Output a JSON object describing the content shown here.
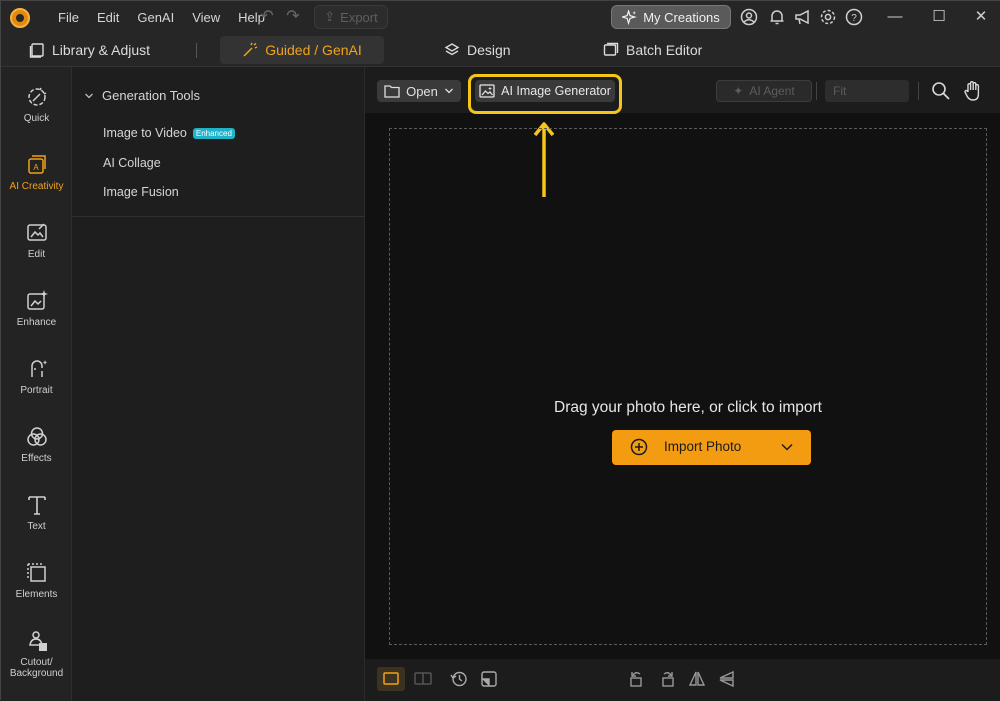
{
  "menu": [
    "File",
    "Edit",
    "GenAI",
    "View",
    "Help"
  ],
  "toolbar_top": {
    "export_label": "Export",
    "my_creations_label": "My Creations"
  },
  "nav": {
    "library": "Library & Adjust",
    "guided": "Guided / GenAI",
    "design": "Design",
    "batch": "Batch Editor"
  },
  "rail": [
    {
      "label": "Quick",
      "icon": "magic-wand-icon"
    },
    {
      "label": "AI Creativity",
      "icon": "ai-creativity-icon"
    },
    {
      "label": "Edit",
      "icon": "edit-image-icon"
    },
    {
      "label": "Enhance",
      "icon": "enhance-icon"
    },
    {
      "label": "Portrait",
      "icon": "portrait-icon"
    },
    {
      "label": "Effects",
      "icon": "effects-icon"
    },
    {
      "label": "Text",
      "icon": "text-icon"
    },
    {
      "label": "Elements",
      "icon": "elements-icon"
    },
    {
      "label": "Cutout/",
      "label2": "Background",
      "icon": "cutout-icon"
    }
  ],
  "panel": {
    "heading": "Generation Tools",
    "items": [
      {
        "label": "Image to Video",
        "badge": "Enhanced"
      },
      {
        "label": "AI Collage"
      },
      {
        "label": "Image Fusion"
      }
    ]
  },
  "workspace": {
    "open_label": "Open",
    "ai_image_generator_label": "AI Image Generator",
    "ai_agent_label": "AI Agent",
    "fit_value": "Fit",
    "drop_text": "Drag your photo here, or click to import",
    "import_label": "Import Photo"
  },
  "colors": {
    "accent": "#f39c12",
    "highlight": "#f5c518",
    "badge": "#1fb3c9"
  }
}
